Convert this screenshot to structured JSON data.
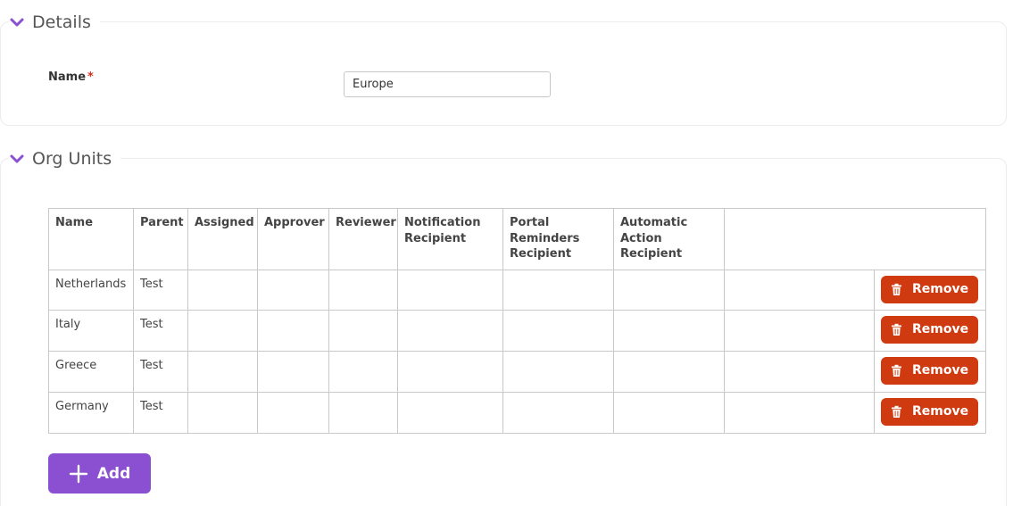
{
  "colors": {
    "accent": "#8b4fd1",
    "danger": "#d03a10",
    "required": "#d62d20"
  },
  "details": {
    "title": "Details",
    "name_label": "Name",
    "required_mark": "*",
    "name_value": "Europe"
  },
  "org_units": {
    "title": "Org Units",
    "columns": [
      "Name",
      "Parent",
      "Assigned",
      "Approver",
      "Reviewer",
      "Notification Recipient",
      "Portal Reminders Recipient",
      "Automatic Action Recipient"
    ],
    "rows": [
      {
        "name": "Netherlands",
        "parent": "Test",
        "remove_label": "Remove"
      },
      {
        "name": "Italy",
        "parent": "Test",
        "remove_label": "Remove"
      },
      {
        "name": "Greece",
        "parent": "Test",
        "remove_label": "Remove"
      },
      {
        "name": "Germany",
        "parent": "Test",
        "remove_label": "Remove"
      }
    ],
    "add_label": "Add"
  },
  "icons": {
    "collapse": "chevron-down-icon",
    "remove": "trash-icon",
    "add": "plus-icon"
  }
}
